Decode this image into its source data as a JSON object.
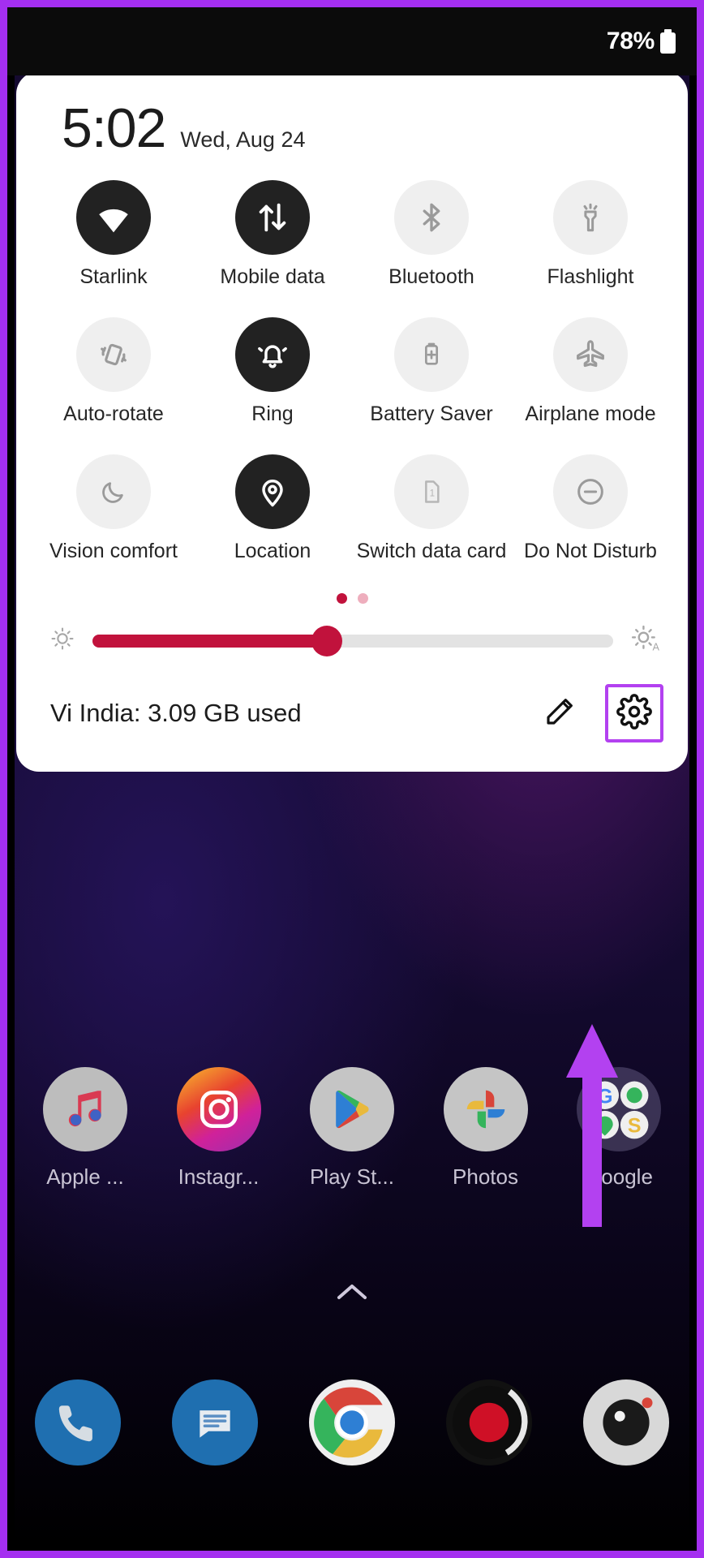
{
  "status_bar": {
    "battery_percent": "78%",
    "battery_icon": "battery-icon"
  },
  "quick_settings": {
    "time": "5:02",
    "date": "Wed, Aug 24",
    "tiles": [
      {
        "label": "Starlink",
        "icon": "wifi-icon",
        "active": true
      },
      {
        "label": "Mobile data",
        "icon": "mobile-data-icon",
        "active": true
      },
      {
        "label": "Bluetooth",
        "icon": "bluetooth-icon",
        "active": false
      },
      {
        "label": "Flashlight",
        "icon": "flashlight-icon",
        "active": false
      },
      {
        "label": "Auto-rotate",
        "icon": "auto-rotate-icon",
        "active": false
      },
      {
        "label": "Ring",
        "icon": "bell-icon",
        "active": true
      },
      {
        "label": "Battery Saver",
        "icon": "battery-saver-icon",
        "active": false
      },
      {
        "label": "Airplane mode",
        "icon": "airplane-icon",
        "active": false
      },
      {
        "label": "Vision comfort",
        "icon": "moon-icon",
        "active": false
      },
      {
        "label": "Location",
        "icon": "location-pin-icon",
        "active": true
      },
      {
        "label": "Switch data card",
        "icon": "sim-card-icon",
        "active": false
      },
      {
        "label": "Do Not Disturb",
        "icon": "minus-circle-icon",
        "active": false
      }
    ],
    "pager": {
      "pages": 2,
      "current": 1
    },
    "brightness": {
      "value_percent": 45,
      "low_icon": "brightness-low-icon",
      "auto_icon": "brightness-auto-icon"
    },
    "footer": {
      "data_usage": "Vi India: 3.09 GB used",
      "edit_icon": "pencil-icon",
      "settings_icon": "gear-icon"
    }
  },
  "home_screen": {
    "apps": [
      {
        "label": "Apple ...",
        "icon": "apple-music-icon"
      },
      {
        "label": "Instagr...",
        "icon": "instagram-icon"
      },
      {
        "label": "Play St...",
        "icon": "play-store-icon"
      },
      {
        "label": "Photos",
        "icon": "google-photos-icon"
      },
      {
        "label": "Google",
        "icon": "google-folder-icon"
      }
    ],
    "drawer_handle_icon": "chevron-up-icon",
    "dock": [
      {
        "icon": "phone-icon"
      },
      {
        "icon": "messages-icon"
      },
      {
        "icon": "chrome-icon"
      },
      {
        "icon": "red-app-icon"
      },
      {
        "icon": "camera-icon"
      }
    ]
  },
  "annotation": {
    "arrow_icon": "up-arrow-annotation",
    "highlight_color": "#b341f0",
    "frame_color": "#a42ff0"
  },
  "colors": {
    "accent": "#c1123c",
    "tile_on": "#222222",
    "tile_off": "#efefef"
  }
}
